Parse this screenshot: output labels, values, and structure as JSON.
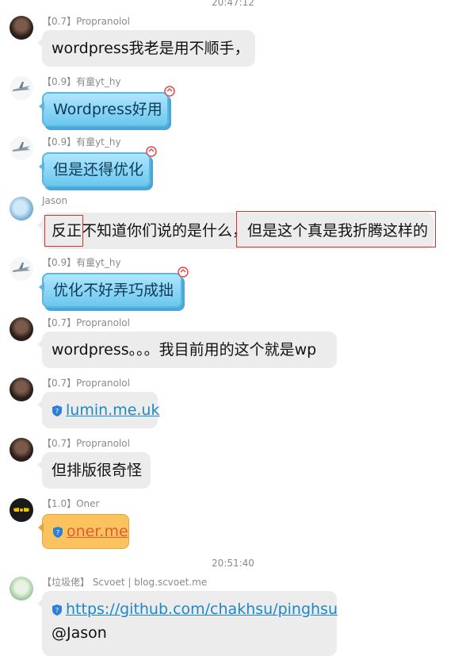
{
  "timestamps": [
    "20:47:12",
    "20:51:40"
  ],
  "messages": [
    {
      "sender": "【0.7】Propranolol",
      "text": "wordpress我老是用不顺手，",
      "avatar": "portrait-avatar"
    },
    {
      "sender": "【0.9】有童yt_hy",
      "text": "Wordpress好用",
      "avatar": "plane-avatar"
    },
    {
      "sender": "【0.9】有童yt_hy",
      "text": "但是还得优化",
      "avatar": "plane-avatar"
    },
    {
      "sender": "Jason",
      "text_part1": "反正",
      "text_part2": "不知道你们说的是什么，",
      "text_part3": "但是这个真是我折腾这样的",
      "avatar": "sky-avatar"
    },
    {
      "sender": "【0.9】有童yt_hy",
      "text": "优化不好弄巧成拙",
      "avatar": "plane-avatar"
    },
    {
      "sender": "【0.7】Propranolol",
      "text": "wordpress。。。我目前用的这个就是wp",
      "avatar": "portrait-avatar"
    },
    {
      "sender": "【0.7】Propranolol",
      "text": "lumin.me.uk",
      "avatar": "portrait-avatar"
    },
    {
      "sender": "【0.7】Propranolol",
      "text": "但排版很奇怪",
      "avatar": "portrait-avatar"
    },
    {
      "sender": "【1.0】Oner",
      "text": "oner.me",
      "avatar": "mask-avatar"
    },
    {
      "sender": "【垃圾佬】 Scvoet | blog.scvoet.me",
      "text": "https://github.com/chakhsu/pinghsu",
      "text2": "@Jason",
      "avatar": "anime-avatar"
    }
  ],
  "colors": {
    "bubble_gray": "#ececec",
    "bubble_blue": "#7fd1f3",
    "bubble_orange": "#fbc35e",
    "link_blue": "#1e88c7",
    "link_red": "#e25b33",
    "highlight_red": "#d9312b"
  }
}
